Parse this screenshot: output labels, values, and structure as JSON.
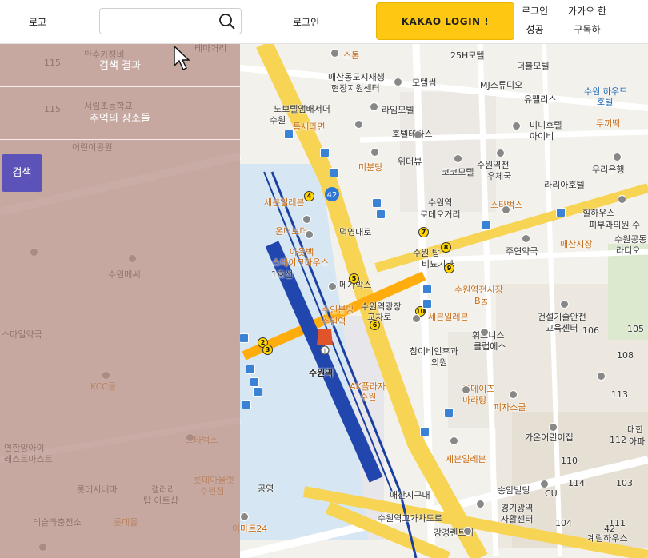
{
  "header": {
    "logo": "로고",
    "search": {
      "placeholder": "",
      "value": ""
    },
    "login_link": "로그인",
    "kakao_button": "KAKAO LOGIN !",
    "login_success": [
      "로그인",
      "성공"
    ],
    "kakao_signup": [
      "카카오 한",
      "구독하"
    ]
  },
  "sidebar": {
    "search_results": "검색 결과",
    "memory_places": "추억의 장소들",
    "search_button": "검색"
  },
  "map": {
    "station": "수원역",
    "labels": [
      {
        "t": "만수카정비",
        "c": ""
      },
      {
        "t": "테마거리",
        "c": ""
      },
      {
        "t": "스톤",
        "c": "orange"
      },
      {
        "t": "25H모텔",
        "c": ""
      },
      {
        "t": "더블모텔",
        "c": ""
      },
      {
        "t": "매산동도시재생",
        "c": ""
      },
      {
        "t": "현장지원센터",
        "c": ""
      },
      {
        "t": "모텔썸",
        "c": ""
      },
      {
        "t": "MJ스튜디오",
        "c": ""
      },
      {
        "t": "수원 하우드",
        "c": "blue"
      },
      {
        "t": "호텔",
        "c": "blue"
      },
      {
        "t": "유팰리스",
        "c": ""
      },
      {
        "t": "노보텔앰배서더",
        "c": ""
      },
      {
        "t": "수원",
        "c": ""
      },
      {
        "t": "라임모텔",
        "c": ""
      },
      {
        "t": "틈새라면",
        "c": "orange"
      },
      {
        "t": "미니호텔",
        "c": ""
      },
      {
        "t": "아이비",
        "c": ""
      },
      {
        "t": "두끼떡",
        "c": "orange"
      },
      {
        "t": "호텔테라스",
        "c": ""
      },
      {
        "t": "위더뷰",
        "c": ""
      },
      {
        "t": "미분당",
        "c": "orange"
      },
      {
        "t": "코코모텔",
        "c": ""
      },
      {
        "t": "수원역전",
        "c": ""
      },
      {
        "t": "우체국",
        "c": ""
      },
      {
        "t": "우리은행",
        "c": ""
      },
      {
        "t": "라리아호텔",
        "c": ""
      },
      {
        "t": "세븐일레븐",
        "c": "orange"
      },
      {
        "t": "수원역",
        "c": ""
      },
      {
        "t": "로데오거리",
        "c": ""
      },
      {
        "t": "스타벅스",
        "c": "orange"
      },
      {
        "t": "힐하우스",
        "c": ""
      },
      {
        "t": "피부과의원 수",
        "c": ""
      },
      {
        "t": "온더보더",
        "c": "orange"
      },
      {
        "t": "매산시장",
        "c": "orange"
      },
      {
        "t": "수원공동",
        "c": ""
      },
      {
        "t": "라디오",
        "c": ""
      },
      {
        "t": "아웃백",
        "c": "orange"
      },
      {
        "t": "스테이크하우스",
        "c": "orange"
      },
      {
        "t": "수원 탑",
        "c": ""
      },
      {
        "t": "비뇨기과",
        "c": ""
      },
      {
        "t": "주연약국",
        "c": ""
      },
      {
        "t": "덕영대로",
        "c": ""
      },
      {
        "t": "메가박스",
        "c": ""
      },
      {
        "t": "수원역전시장",
        "c": "orange"
      },
      {
        "t": "B동",
        "c": "orange"
      },
      {
        "t": "1호선",
        "c": ""
      },
      {
        "t": "수인분당",
        "c": "orange"
      },
      {
        "t": "수원역",
        "c": "orange"
      },
      {
        "t": "수원역광장",
        "c": ""
      },
      {
        "t": "교차로",
        "c": ""
      },
      {
        "t": "세븐일레븐",
        "c": "orange"
      },
      {
        "t": "건설기술안전",
        "c": ""
      },
      {
        "t": "교육센터",
        "c": ""
      },
      {
        "t": "휘트니스",
        "c": ""
      },
      {
        "t": "클럽에스",
        "c": ""
      },
      {
        "t": "참이비인후과",
        "c": ""
      },
      {
        "t": "의원",
        "c": ""
      },
      {
        "t": "AK플라자",
        "c": "orange"
      },
      {
        "t": "수원",
        "c": "orange"
      },
      {
        "t": "라메이즈",
        "c": "orange"
      },
      {
        "t": "마라탕",
        "c": "orange"
      },
      {
        "t": "피자스쿨",
        "c": "orange"
      },
      {
        "t": "가온어린이집",
        "c": ""
      },
      {
        "t": "대한",
        "c": ""
      },
      {
        "t": "아파",
        "c": ""
      },
      {
        "t": "세븐일레븐",
        "c": "orange"
      },
      {
        "t": "매산지구대",
        "c": ""
      },
      {
        "t": "송암빌딩",
        "c": ""
      },
      {
        "t": "CU",
        "c": ""
      },
      {
        "t": "경기광역",
        "c": ""
      },
      {
        "t": "자활센터",
        "c": ""
      },
      {
        "t": "수원역고가차도로",
        "c": ""
      },
      {
        "t": "강경렌트카",
        "c": ""
      },
      {
        "t": "이마트24",
        "c": "orange"
      },
      {
        "t": "계림하우스",
        "c": ""
      },
      {
        "t": "서림초등학교",
        "c": ""
      },
      {
        "t": "어린이공원",
        "c": ""
      },
      {
        "t": "수원메쎄",
        "c": ""
      },
      {
        "t": "스마일약국",
        "c": ""
      },
      {
        "t": "KCC몰",
        "c": "orange"
      },
      {
        "t": "연한양아이",
        "c": ""
      },
      {
        "t": "래스트마스트",
        "c": ""
      },
      {
        "t": "스타벅스",
        "c": "orange"
      },
      {
        "t": "롯데아울렛",
        "c": "orange"
      },
      {
        "t": "수원점",
        "c": "orange"
      },
      {
        "t": "롯데시네마",
        "c": ""
      },
      {
        "t": "갤러리",
        "c": ""
      },
      {
        "t": "탑 아트샵",
        "c": ""
      },
      {
        "t": "공영",
        "c": ""
      },
      {
        "t": "테슬라충전소",
        "c": ""
      },
      {
        "t": "롯데몰",
        "c": "orange"
      },
      {
        "t": "이마트24",
        "c": "orange"
      },
      {
        "t": "115",
        "c": ""
      },
      {
        "t": "115",
        "c": ""
      },
      {
        "t": "106",
        "c": ""
      },
      {
        "t": "105",
        "c": ""
      },
      {
        "t": "108",
        "c": ""
      },
      {
        "t": "113",
        "c": ""
      },
      {
        "t": "112",
        "c": ""
      },
      {
        "t": "110",
        "c": ""
      },
      {
        "t": "114",
        "c": ""
      },
      {
        "t": "103",
        "c": ""
      },
      {
        "t": "111",
        "c": ""
      },
      {
        "t": "104",
        "c": ""
      },
      {
        "t": "42",
        "c": ""
      }
    ],
    "numbers": [
      "2",
      "3",
      "4",
      "5",
      "6",
      "7",
      "8",
      "9",
      "10"
    ]
  }
}
